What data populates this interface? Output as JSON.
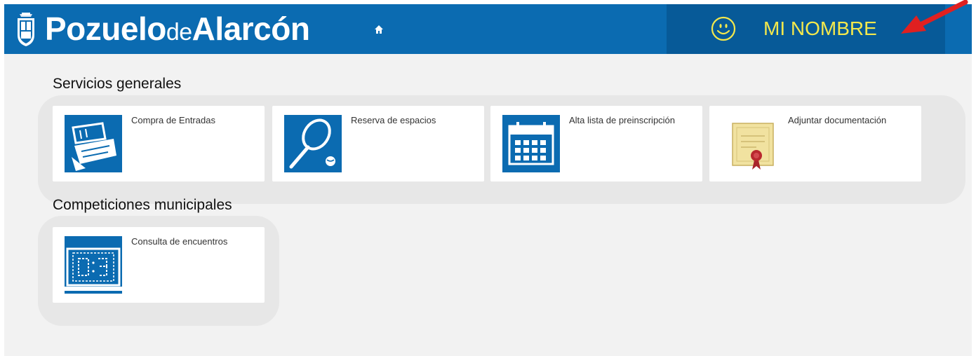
{
  "header": {
    "brand_part1": "Pozuelo",
    "brand_part2": "de",
    "brand_part3": "Alarcón",
    "user_name": "MI NOMBRE"
  },
  "colors": {
    "header_blue": "#0b6bb1",
    "user_box_blue": "#075a98",
    "user_name_yellow": "#f4e84c",
    "icon_blue": "#0b6bb1",
    "arrow_red": "#e02020"
  },
  "sections": [
    {
      "title": "Servicios generales",
      "tiles": [
        {
          "label": "Compra de Entradas",
          "icon": "tickets-icon"
        },
        {
          "label": "Reserva de espacios",
          "icon": "tennis-racket-icon"
        },
        {
          "label": "Alta lista de preinscripción",
          "icon": "calendar-icon"
        },
        {
          "label": "Adjuntar documentación",
          "icon": "certificate-icon"
        }
      ]
    },
    {
      "title": "Competiciones municipales",
      "tiles": [
        {
          "label": "Consulta de encuentros",
          "icon": "scoreboard-icon"
        }
      ]
    }
  ]
}
